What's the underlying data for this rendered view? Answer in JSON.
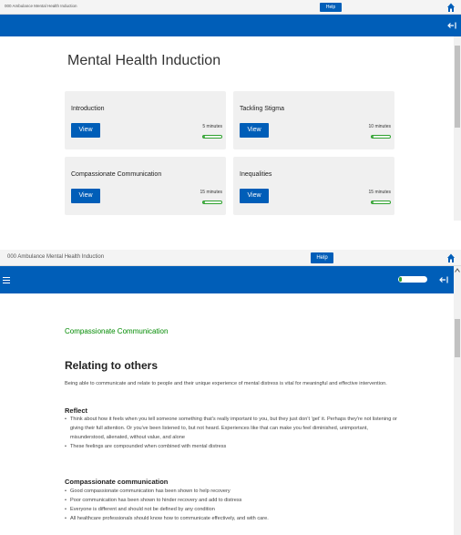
{
  "app": {
    "title": "000 Ambulance Mental Health Induction",
    "help_label": "Help"
  },
  "course": {
    "title": "Mental Health Induction",
    "cards": [
      {
        "title": "Introduction",
        "view_label": "View",
        "duration": "5 minutes",
        "progress": 0.08
      },
      {
        "title": "Tackling Stigma",
        "view_label": "View",
        "duration": "10 minutes",
        "progress": 0.08
      },
      {
        "title": "Compassionate Communication",
        "view_label": "View",
        "duration": "15 minutes",
        "progress": 0.08
      },
      {
        "title": "Inequalities",
        "view_label": "View",
        "duration": "15 minutes",
        "progress": 0.08
      }
    ]
  },
  "module": {
    "progress": 0.08,
    "section_title": "Compassionate Communication",
    "heading": "Relating to others",
    "intro": "Being able to communicate and relate to people and their unique experience of mental distress is vital for meaningful and effective intervention.",
    "reflect_heading": "Reflect",
    "reflect_items": [
      "Think about how it feels when you tell someone something that's really important to you, but they just don't 'get' it. Perhaps they're not listening or giving their full attention. Or you've been listened to, but not heard. Experiences like that can make you feel diminished, unimportant, misunderstood, alienated, without value, and alone",
      "These feelings are compounded when combined with mental distress"
    ],
    "cc_heading": "Compassionate communication",
    "cc_items": [
      "Good compassionate communication has been shown to help recovery",
      "Poor communication has been shown to hinder recovery and add to distress",
      "Everyone is different and should not be defined by any condition",
      "All healthcare professionals should know how to communicate effectively, and with care."
    ]
  },
  "colors": {
    "brand_blue": "#005eb8",
    "progress_green": "#2ea12e",
    "section_green": "#008a00"
  },
  "icons": {
    "home": "home-icon",
    "exit": "exit-icon",
    "menu": "menu-icon",
    "scroll_up": "chevron-up-icon"
  }
}
